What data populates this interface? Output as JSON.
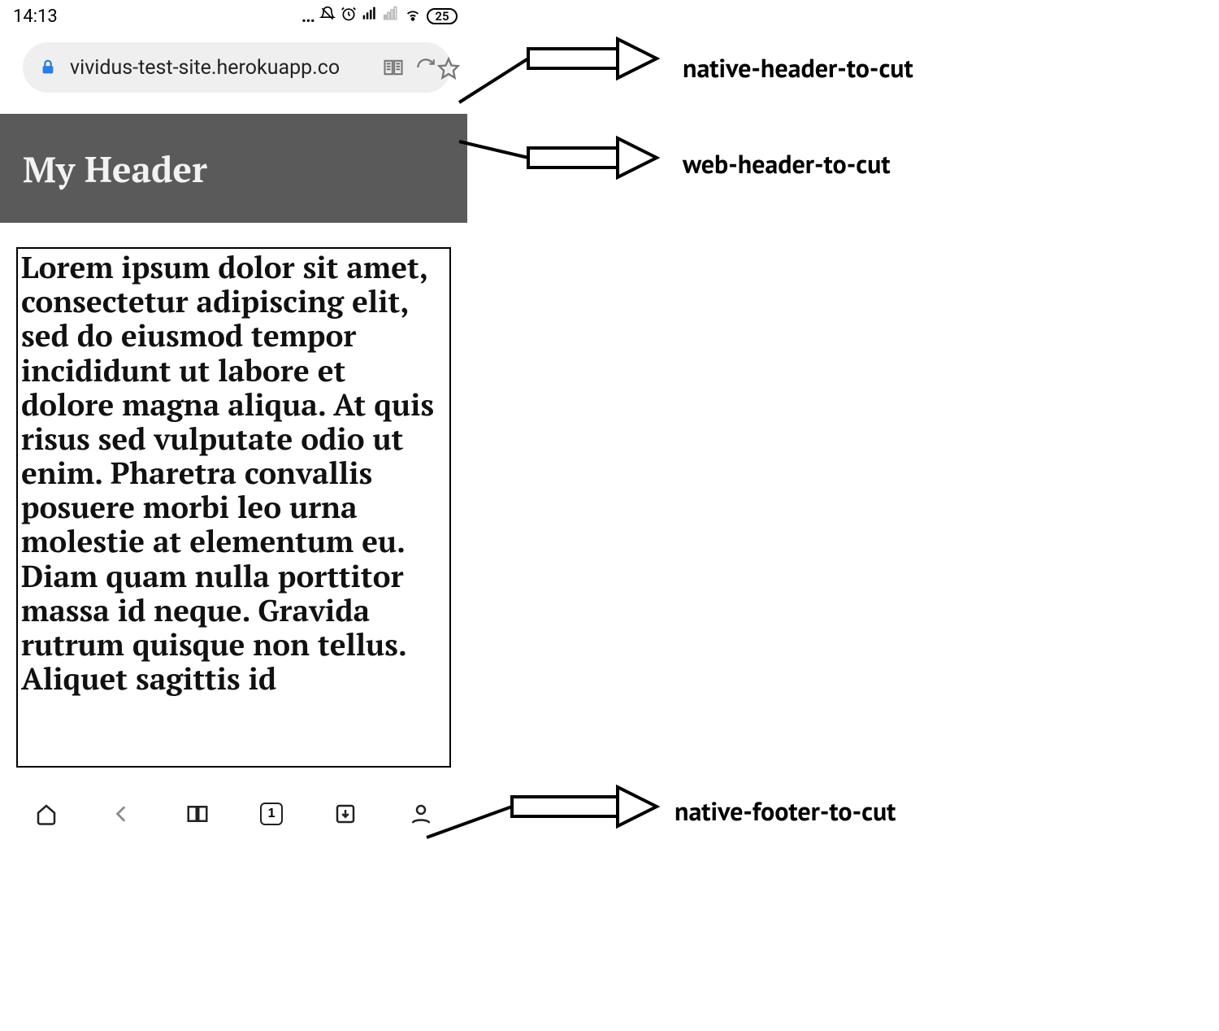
{
  "status_bar": {
    "time": "14:13",
    "dots": "...",
    "battery_percent": "25"
  },
  "address_bar": {
    "url": "vividus-test-site.herokuapp.co"
  },
  "web_header": {
    "title": "My Header"
  },
  "paragraph": {
    "text": "Lorem ipsum dolor sit amet, consectetur adipiscing elit, sed do eiusmod tempor incididunt ut labore et dolore magna aliqua. At quis risus sed vulputate odio ut enim. Pharetra convallis posuere morbi leo urna molestie at elementum eu. Diam quam nulla porttitor massa id neque. Gravida rutrum quisque non tellus. Aliquet sagittis id"
  },
  "native_footer": {
    "tab_count": "1"
  },
  "annotations": {
    "native_header": "native-header-to-cut",
    "web_header": "web-header-to-cut",
    "native_footer": "native-footer-to-cut"
  }
}
